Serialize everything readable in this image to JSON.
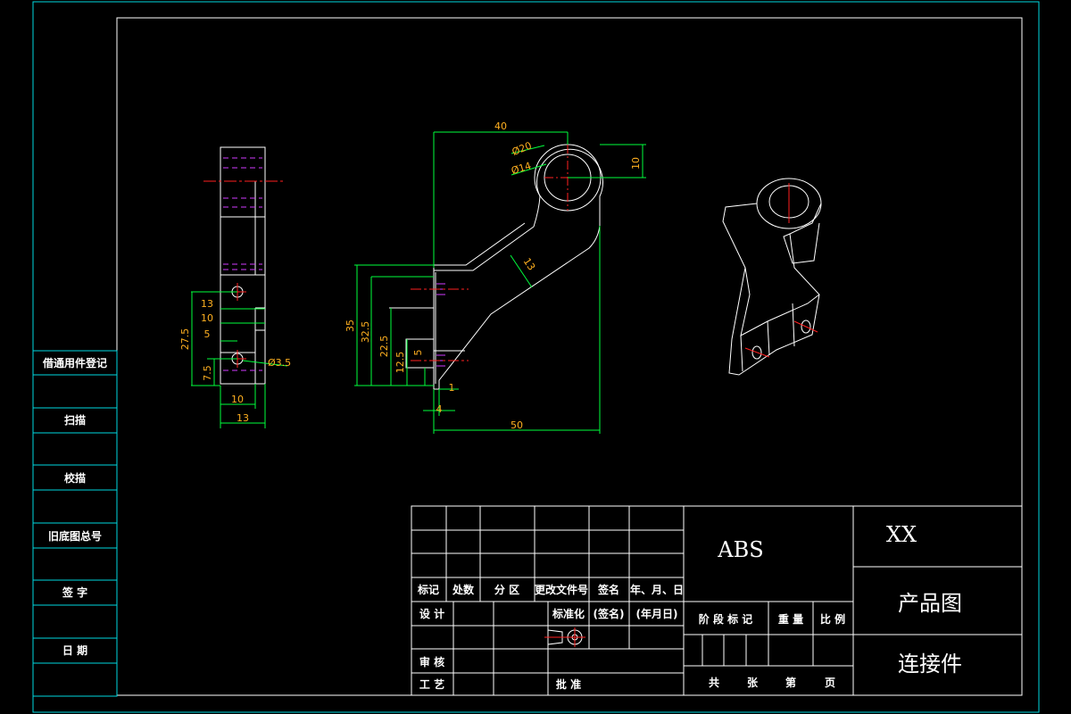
{
  "side_column": {
    "labels": [
      "借通用件登记",
      "扫描",
      "校描",
      "旧底图总号",
      "签 字",
      "日 期"
    ]
  },
  "dimensions": {
    "side_view": {
      "d13": "13",
      "d10": "10",
      "d5": "5",
      "d27_5": "27.5",
      "d7_5": "7.5",
      "hole": "Ø3.5",
      "w10": "10",
      "w13": "13"
    },
    "front_view": {
      "d40": "40",
      "dia20": "Ø20",
      "dia14": "Ø14",
      "d10": "10",
      "d13": "13",
      "d35": "35",
      "d32_5": "32.5",
      "d22_5": "22.5",
      "d12_5": "12.5",
      "d5": "5",
      "d1": "1",
      "d4": "4",
      "d50": "50"
    }
  },
  "title_block": {
    "headers": {
      "mark": "标记",
      "count": "处数",
      "zone": "分 区",
      "doc_no": "更改文件号",
      "sign": "签名",
      "date": "年、月、日"
    },
    "rows": {
      "design": "设 计",
      "standardize": "标准化",
      "sign_paren": "(签名)",
      "date_paren": "(年月日)",
      "review": "审 核",
      "process": "工 艺",
      "approve": "批 准"
    },
    "material": "ABS",
    "stage_labels": {
      "stage": "阶 段 标 记",
      "weight": "重 量",
      "scale": "比 例"
    },
    "sheet_labels": {
      "total": "共",
      "sheets": "张",
      "nth": "第",
      "page": "页"
    },
    "company": "XX",
    "drawing_type": "产品图",
    "part_name": "连接件"
  }
}
